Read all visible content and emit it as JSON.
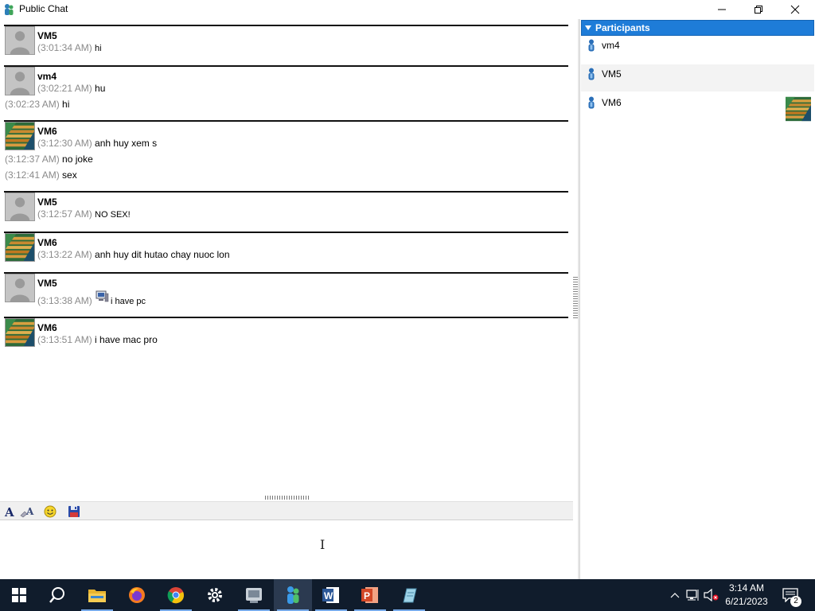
{
  "window": {
    "title": "Public Chat"
  },
  "chat": {
    "groups": [
      {
        "sender": "VM5",
        "avatar": "default-avatar",
        "lines": [
          {
            "ts": "(3:01:34 AM)",
            "text": "hi",
            "small": true
          }
        ]
      },
      {
        "sender": "vm4",
        "avatar": "default-avatar",
        "lines": [
          {
            "ts": "(3:02:21 AM)",
            "text": "hu"
          },
          {
            "ts": "(3:02:23 AM)",
            "text": "hi"
          }
        ]
      },
      {
        "sender": "VM6",
        "avatar": "stairs-avatar",
        "lines": [
          {
            "ts": "(3:12:30 AM)",
            "text": "anh huy xem s"
          },
          {
            "ts": "(3:12:37 AM)",
            "text": "no joke"
          },
          {
            "ts": "(3:12:41 AM)",
            "text": "sex"
          }
        ]
      },
      {
        "sender": "VM5",
        "avatar": "default-avatar",
        "lines": [
          {
            "ts": "(3:12:57 AM)",
            "text": "NO SEX!",
            "small": true
          }
        ]
      },
      {
        "sender": "VM6",
        "avatar": "stairs-avatar",
        "lines": [
          {
            "ts": "(3:13:22 AM)",
            "text": "anh huy dit hutao chay nuoc lon"
          }
        ]
      },
      {
        "sender": "VM5",
        "avatar": "default-avatar",
        "lines": [
          {
            "ts": "(3:13:38 AM)",
            "text": "i have pc",
            "small": true,
            "emoticon": "computer-icon"
          }
        ]
      },
      {
        "sender": "VM6",
        "avatar": "stairs-avatar",
        "lines": [
          {
            "ts": "(3:13:51 AM)",
            "text": "i have mac pro"
          }
        ]
      }
    ]
  },
  "toolbar": {
    "tools": [
      "font-icon",
      "text-color-icon",
      "smiley-icon",
      "save-icon"
    ]
  },
  "participants": {
    "header": "Participants",
    "items": [
      {
        "name": "vm4",
        "has_avatar": false
      },
      {
        "name": "VM5",
        "has_avatar": false
      },
      {
        "name": "VM6",
        "has_avatar": true
      }
    ]
  },
  "taskbar": {
    "apps": [
      "start-icon",
      "search-icon",
      "file-explorer-icon",
      "firefox-icon",
      "chrome-icon",
      "settings-icon",
      "network-app-icon",
      "chat-app-icon",
      "word-icon",
      "powerpoint-icon",
      "notepad-icon"
    ],
    "time": "3:14 AM",
    "date": "6/21/2023",
    "notifications": "2"
  },
  "colors": {
    "header_blue": "#1e7cd8",
    "timestamp_gray": "#8a8a8a",
    "taskbar": "#101c2c"
  }
}
